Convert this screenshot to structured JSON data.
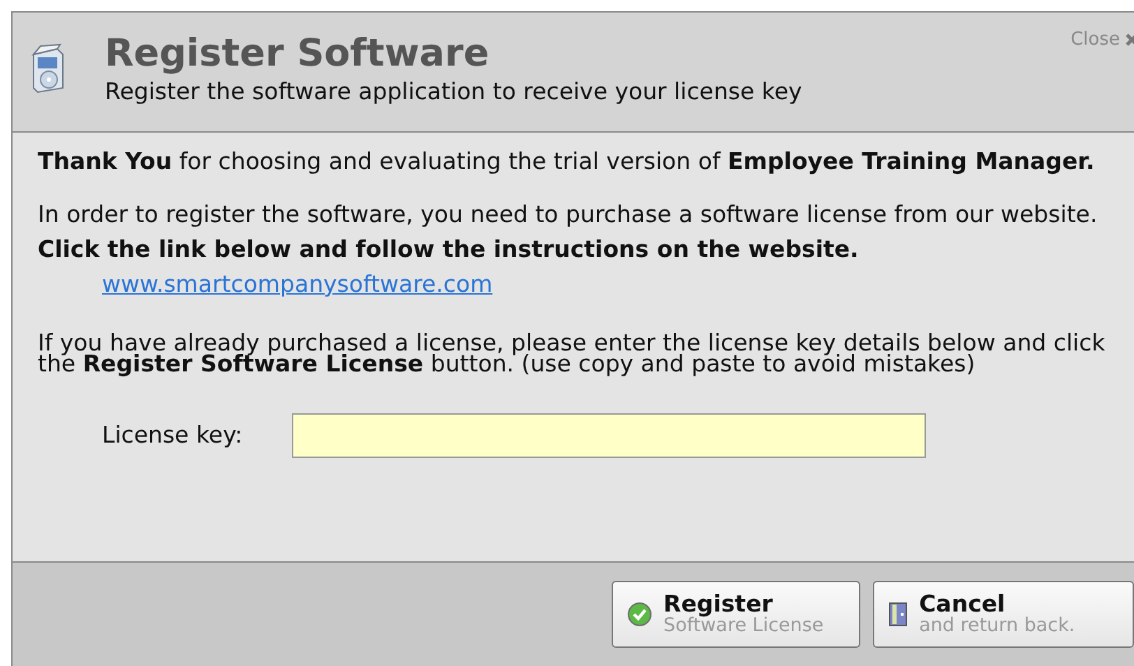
{
  "window": {
    "title": "Register Software",
    "subtitle": "Register the software application to receive your license key",
    "close_label": "Close"
  },
  "body": {
    "thanks": "**Thank You** for choosing and evaluating the trial version of **Employee Training Manager.**",
    "purchase": "In order to register the software, you need to purchase a software license from our website.",
    "instruction": "Click the link below and follow the instructions on the website.",
    "link": "www.smartcompanysoftware.com",
    "already": "If you have already purchased a license, please enter the license key details below and click the **Register Software License** button. (use copy and paste to avoid mistakes)"
  },
  "license_field": {
    "label": "License key:"
  },
  "buttons": [
    {
      "kind": "register",
      "title": "Register",
      "subtitle": "Software License"
    },
    {
      "kind": "cancel",
      "title": "Cancel",
      "subtitle": "and return back."
    }
  ]
}
